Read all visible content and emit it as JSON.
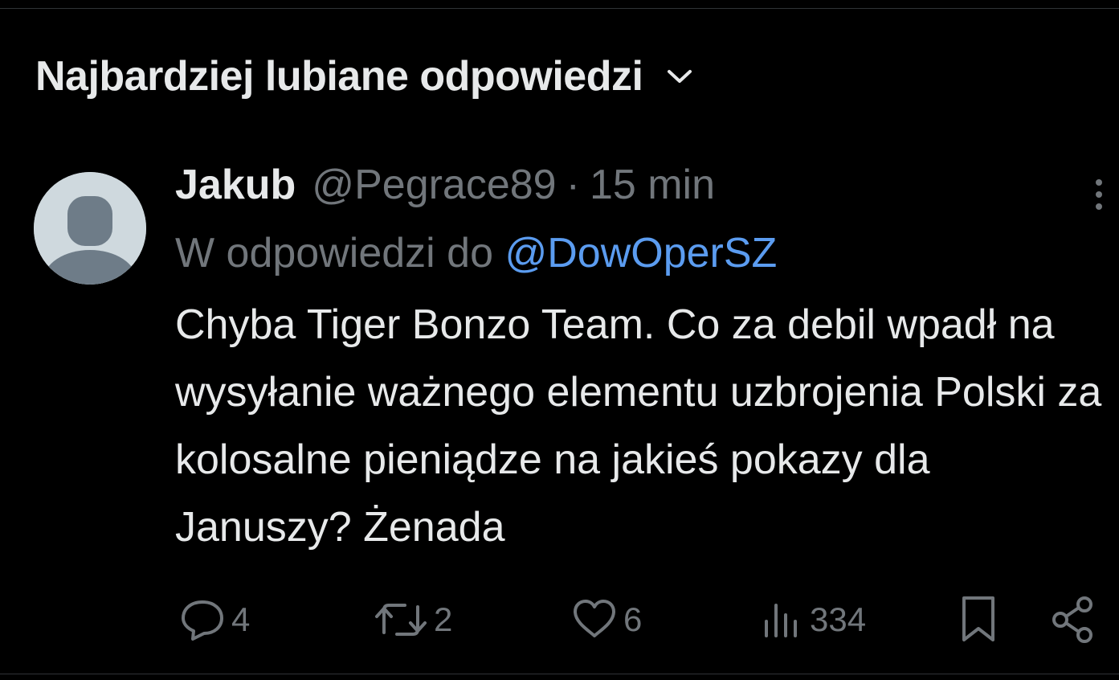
{
  "header": {
    "sort_label": "Najbardziej lubiane odpowiedzi",
    "chevron_icon": "chevron-down-icon"
  },
  "tweet": {
    "avatar_icon": "default-avatar-icon",
    "author_name": "Jakub",
    "author_handle": "@Pegrace89",
    "separator": "·",
    "time": "15 min",
    "reply_prefix": "W odpowiedzi do",
    "reply_to": "@DowOperSZ",
    "text": "Chyba Tiger Bonzo Team. Co za debil wpadł na wysyłanie ważnego elementu uzbrojenia Polski za kolosalne pieniądze na jakieś pokazy dla Januszy? Żenada",
    "more_icon": "more-vertical-icon",
    "actions": {
      "replies": "4",
      "reposts": "2",
      "likes": "6",
      "views": "334"
    }
  },
  "colors": {
    "background": "#000000",
    "text_primary": "#e7e9ea",
    "text_secondary": "#71767b",
    "link": "#5b9cf0",
    "avatar_bg": "#cfd9de",
    "avatar_fg": "#6e7c88"
  }
}
